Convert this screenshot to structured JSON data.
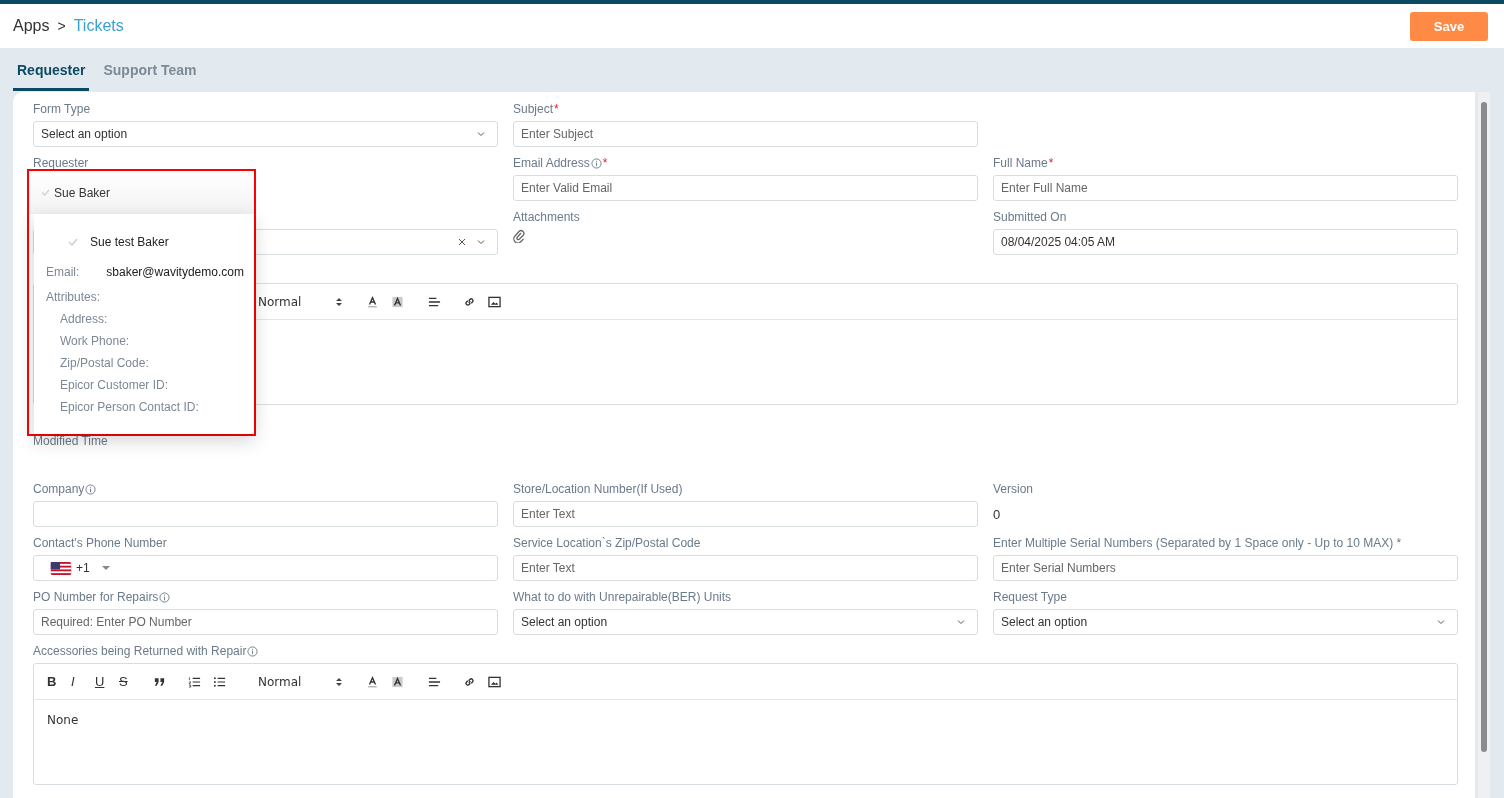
{
  "breadcrumb": {
    "items": [
      {
        "label": "Apps",
        "kind": "plain"
      },
      {
        "label": "Tickets",
        "kind": "link"
      }
    ],
    "separator": ">"
  },
  "save_button": "Save",
  "tabs": [
    {
      "label": "Requester",
      "selected": true
    },
    {
      "label": "Support Team",
      "selected": false
    }
  ],
  "rows": [
    [
      {
        "kind": "select",
        "label": "Form Type",
        "value": "Select an option"
      },
      {
        "kind": "input",
        "label": "Subject",
        "required_mark": "*",
        "placeholder": "Enter Subject"
      }
    ],
    [
      {
        "kind": "label",
        "label": "Requester"
      },
      {
        "kind": "input",
        "label": "Email Address",
        "info": true,
        "required_mark": "*",
        "placeholder": "Enter Valid Email"
      },
      {
        "kind": "input",
        "label": "Full Name",
        "required_mark": "*",
        "placeholder": "Enter Full Name"
      }
    ],
    [
      {
        "kind": "select",
        "clearable": true
      },
      {
        "kind": "attachments",
        "label": "Attachments"
      },
      {
        "kind": "input",
        "label": "Submitted On",
        "value": "08/04/2025 04:05 AM"
      }
    ],
    [
      {
        "kind": "editor",
        "header": "Normal"
      }
    ],
    [
      {
        "kind": "text",
        "label": "Modified Time"
      }
    ],
    [
      {
        "kind": "input",
        "label": "Company",
        "info": true
      },
      {
        "kind": "input",
        "label": "Store/Location Number(If Used)",
        "placeholder": "Enter Text"
      },
      {
        "kind": "text",
        "label": "Version",
        "value": "0"
      }
    ],
    [
      {
        "kind": "phone",
        "label": "Contact's Phone Number",
        "dial_code": "+1"
      },
      {
        "kind": "input",
        "label": "Service Location`s Zip/Postal Code",
        "placeholder": "Enter Text"
      },
      {
        "kind": "input",
        "label": "Enter Multiple Serial Numbers (Separated by 1 Space only - Up to 10 MAX) *",
        "placeholder": "Enter Serial Numbers"
      }
    ],
    [
      {
        "kind": "input",
        "label": "PO Number for Repairs",
        "info": true,
        "placeholder": "Required: Enter PO Number"
      },
      {
        "kind": "select",
        "label": "What to do with Unrepairable(BER) Units",
        "value": "Select an option"
      },
      {
        "kind": "select",
        "label": "Request Type",
        "value": "Select an option"
      }
    ],
    [
      {
        "kind": "editor",
        "label": "Accessories being Returned with Repair",
        "info": true,
        "format_buttons": [
          "B",
          "I",
          "U",
          "S"
        ],
        "header": "Normal",
        "content": "None"
      }
    ]
  ],
  "user_popover": {
    "selected_user": "Sue Baker",
    "name": "Sue test Baker",
    "email_label": "Email:",
    "email": "sbaker@wavitydemo.com",
    "attributes_label": "Attributes:",
    "attributes": [
      "Address:",
      "Work Phone:",
      "Zip/Postal Code:",
      "Epicor Customer ID:",
      "Epicor Person Contact ID:"
    ]
  }
}
